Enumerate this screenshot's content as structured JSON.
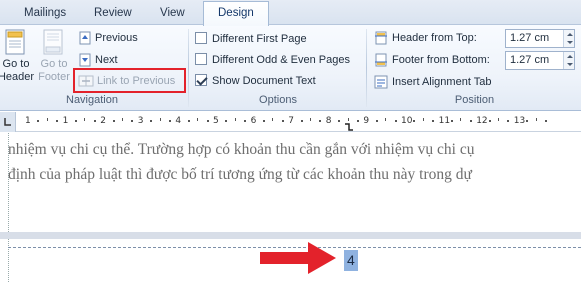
{
  "tabs": [
    {
      "label": "Mailings"
    },
    {
      "label": "Review"
    },
    {
      "label": "View"
    },
    {
      "label": "Design"
    }
  ],
  "navigation": {
    "group_label": "Navigation",
    "go_to_header": "Go to Header",
    "go_to_header_l1": "Go to",
    "go_to_header_l2": "Header",
    "go_to_footer_l1": "Go to",
    "go_to_footer_l2": "Footer",
    "previous": "Previous",
    "next": "Next",
    "link_to_previous": "Link to Previous"
  },
  "options": {
    "group_label": "Options",
    "items": [
      {
        "label": "Different First Page",
        "checked": false
      },
      {
        "label": "Different Odd & Even Pages",
        "checked": false
      },
      {
        "label": "Show Document Text",
        "checked": true
      }
    ]
  },
  "position": {
    "group_label": "Position",
    "header_from_top_label": "Header from Top:",
    "header_from_top_value": "1.27 cm",
    "footer_from_bottom_label": "Footer from Bottom:",
    "footer_from_bottom_value": "1.27 cm",
    "insert_alignment_tab": "Insert Alignment Tab"
  },
  "ruler": {
    "numbers": [
      "1",
      "1",
      "2",
      "3",
      "4",
      "5",
      "6",
      "7",
      "8",
      "9",
      "10",
      "11",
      "12",
      "13"
    ]
  },
  "document": {
    "line1": "nhiệm vụ chi cụ thể. Trường hợp có khoản thu cần gắn với nhiệm vụ chi cụ",
    "line2": "định của pháp luật thì được bố trí tương ứng từ các khoản thu này trong dự",
    "page_number": "4"
  },
  "colors": {
    "annotation_red": "#e3222b",
    "selection": "#8fb2e0"
  }
}
